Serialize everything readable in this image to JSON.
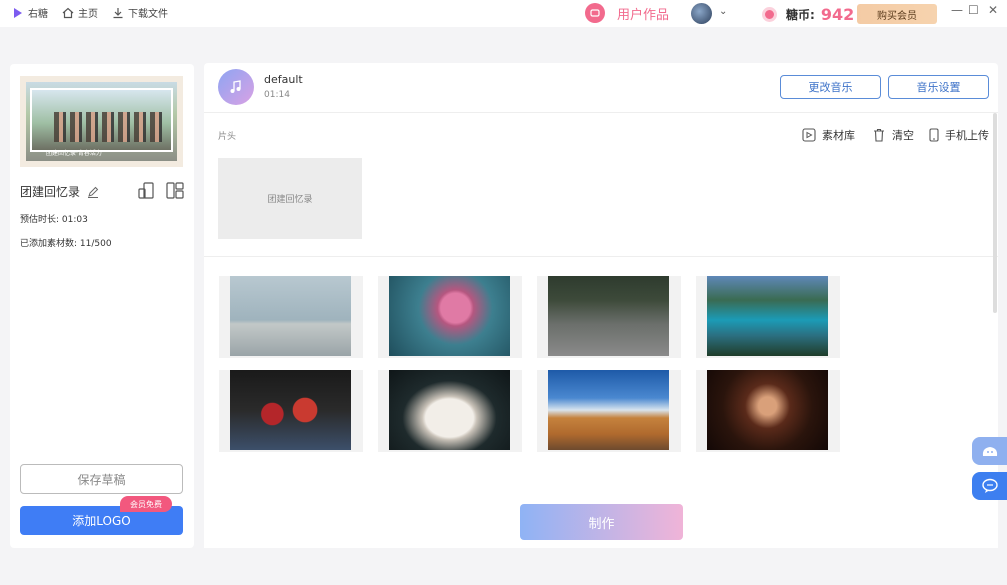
{
  "titlebar": {
    "app_name": "右糖",
    "home": "主页",
    "download": "下载文件",
    "works": "用户作品",
    "coin_label": "糖币:",
    "coin_value": "942",
    "buy_vip": "购买会员",
    "minimize": "—",
    "maximize": "☐",
    "close": "✕"
  },
  "project": {
    "cover_caption": "团建回忆录·青春活力",
    "name": "团建回忆录",
    "duration": "预估时长: 01:03",
    "material_count": "已添加素材数: 11/500",
    "save_draft": "保存草稿",
    "add_logo": "添加LOGO",
    "vip_free": "会员免费"
  },
  "music": {
    "name": "default",
    "time": "01:14",
    "change": "更改音乐",
    "settings": "音乐设置"
  },
  "intro": {
    "label": "片头",
    "library": "素材库",
    "clear": "清空",
    "phone_upload": "手机上传",
    "placeholder": "团建回忆录"
  },
  "make": "制作",
  "thumbnails": [
    {
      "name": "dancer-beach",
      "color": "linear-gradient(180deg,#b8c8d0 0%,#9fb3bd 55%,#c2c8c8 60%,#9aa4a8 100%)"
    },
    {
      "name": "rose",
      "color": "radial-gradient(circle at 55% 40%,#e07aa5 0 18%,#b55780 22%,#3d7f8f 45%,#1f4e5c 100%)"
    },
    {
      "name": "man-ivy-wall",
      "color": "linear-gradient(180deg,#2e3b2e 0%,#3d4a3a 30%,#6b6f6b 60%,#8a8a8a 100%)"
    },
    {
      "name": "lake-forest",
      "color": "linear-gradient(180deg,#5f88b8 0%,#3a6b52 30%,#1b9bb6 55%,#2b6e7f 75%,#1f3d2a 100%)"
    },
    {
      "name": "apples",
      "color": "radial-gradient(circle at 35% 55%,#b4262a 0 12%,transparent 13%),radial-gradient(circle at 62% 50%,#c93a30 0 14%,transparent 15%),linear-gradient(180deg,#1a1a1a 0%,#2a2a2a 50%,#3c4f6a 100%)"
    },
    {
      "name": "swan",
      "color": "radial-gradient(ellipse at 50% 60%,#f2eee8 0 28%,#c9c2b8 32%,#1e2a2c 55%,#0f1618 100%)"
    },
    {
      "name": "desert-road",
      "color": "linear-gradient(180deg,#1e5aa8 0%,#4a88d0 35%,#d8e4ee 50%,#c5823d 60%,#b06a2e 80%,#6e4a2e 100%)"
    },
    {
      "name": "woman-bar",
      "color": "radial-gradient(circle at 50% 45%,#d9a07a 0 12%,#5a2a1a 30%,#2a140c 60%,#130806 100%)"
    }
  ]
}
